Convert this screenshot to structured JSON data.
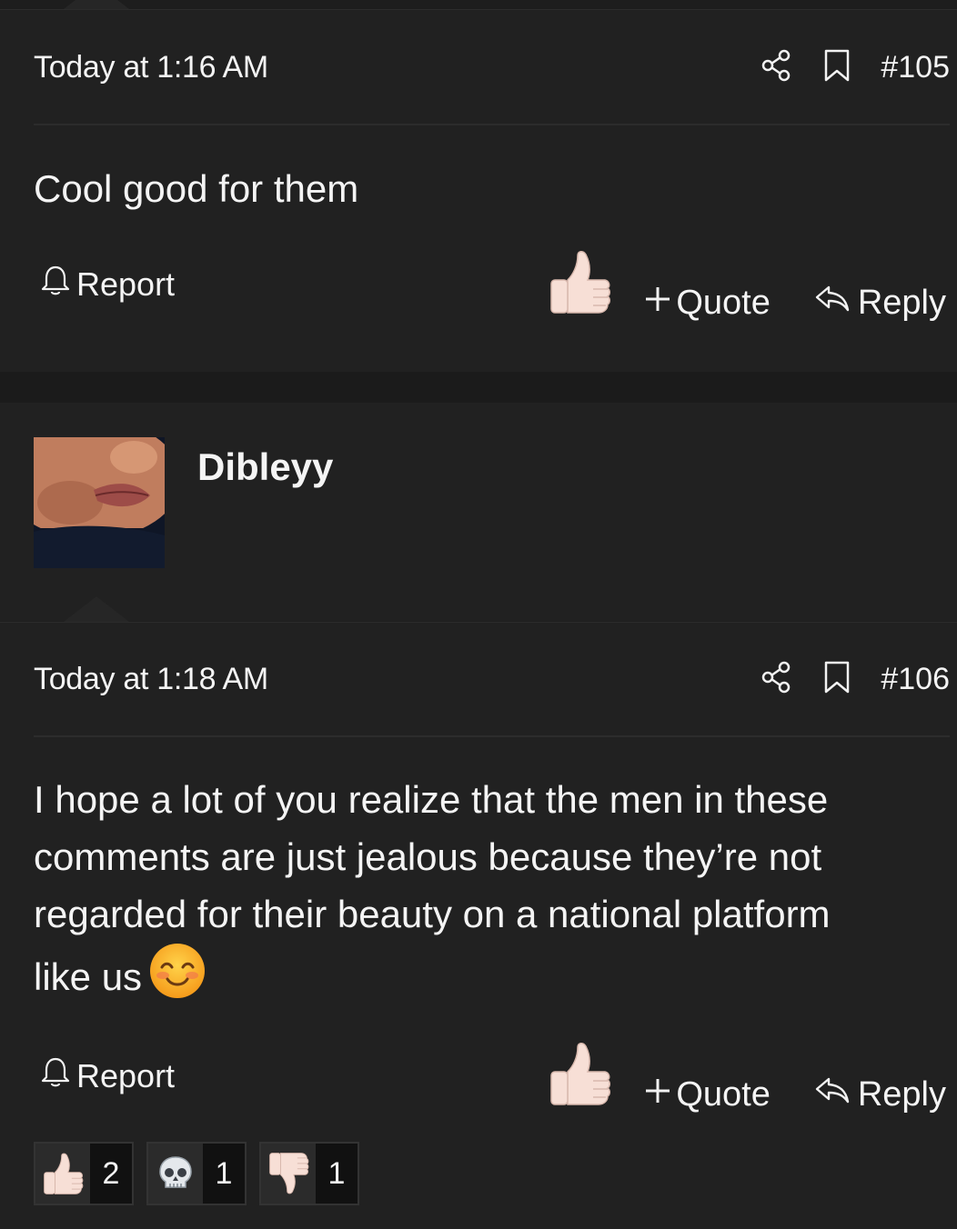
{
  "posts": [
    {
      "timestamp": "Today at 1:16 AM",
      "post_number": "#105",
      "body": "Cool good for them",
      "report_label": "Report",
      "quote_label": "Quote",
      "reply_label": "Reply"
    },
    {
      "author": "Dibleyy",
      "timestamp": "Today at 1:18 AM",
      "post_number": "#106",
      "body_lines": [
        "I hope a lot of you realize that the men in these",
        "comments are just jealous because they’re not",
        "regarded for their beauty on a national platform",
        "like us"
      ],
      "report_label": "Report",
      "quote_label": "Quote",
      "reply_label": "Reply",
      "reactions": [
        {
          "icon": "thumbs-up-icon",
          "count": "2"
        },
        {
          "icon": "skull-icon",
          "count": "1"
        },
        {
          "icon": "thumbs-down-icon",
          "count": "1"
        }
      ]
    }
  ],
  "icons": {
    "share": "share-icon",
    "bookmark": "bookmark-icon",
    "bell": "bell-icon",
    "reply": "reply-arrow-icon",
    "like": "thumbs-up-icon",
    "smile": "smiling-face-icon"
  },
  "colors": {
    "background": "#1d1d1d",
    "card": "#212121",
    "text": "#f4f4f4",
    "divider": "#2c2c2c"
  }
}
